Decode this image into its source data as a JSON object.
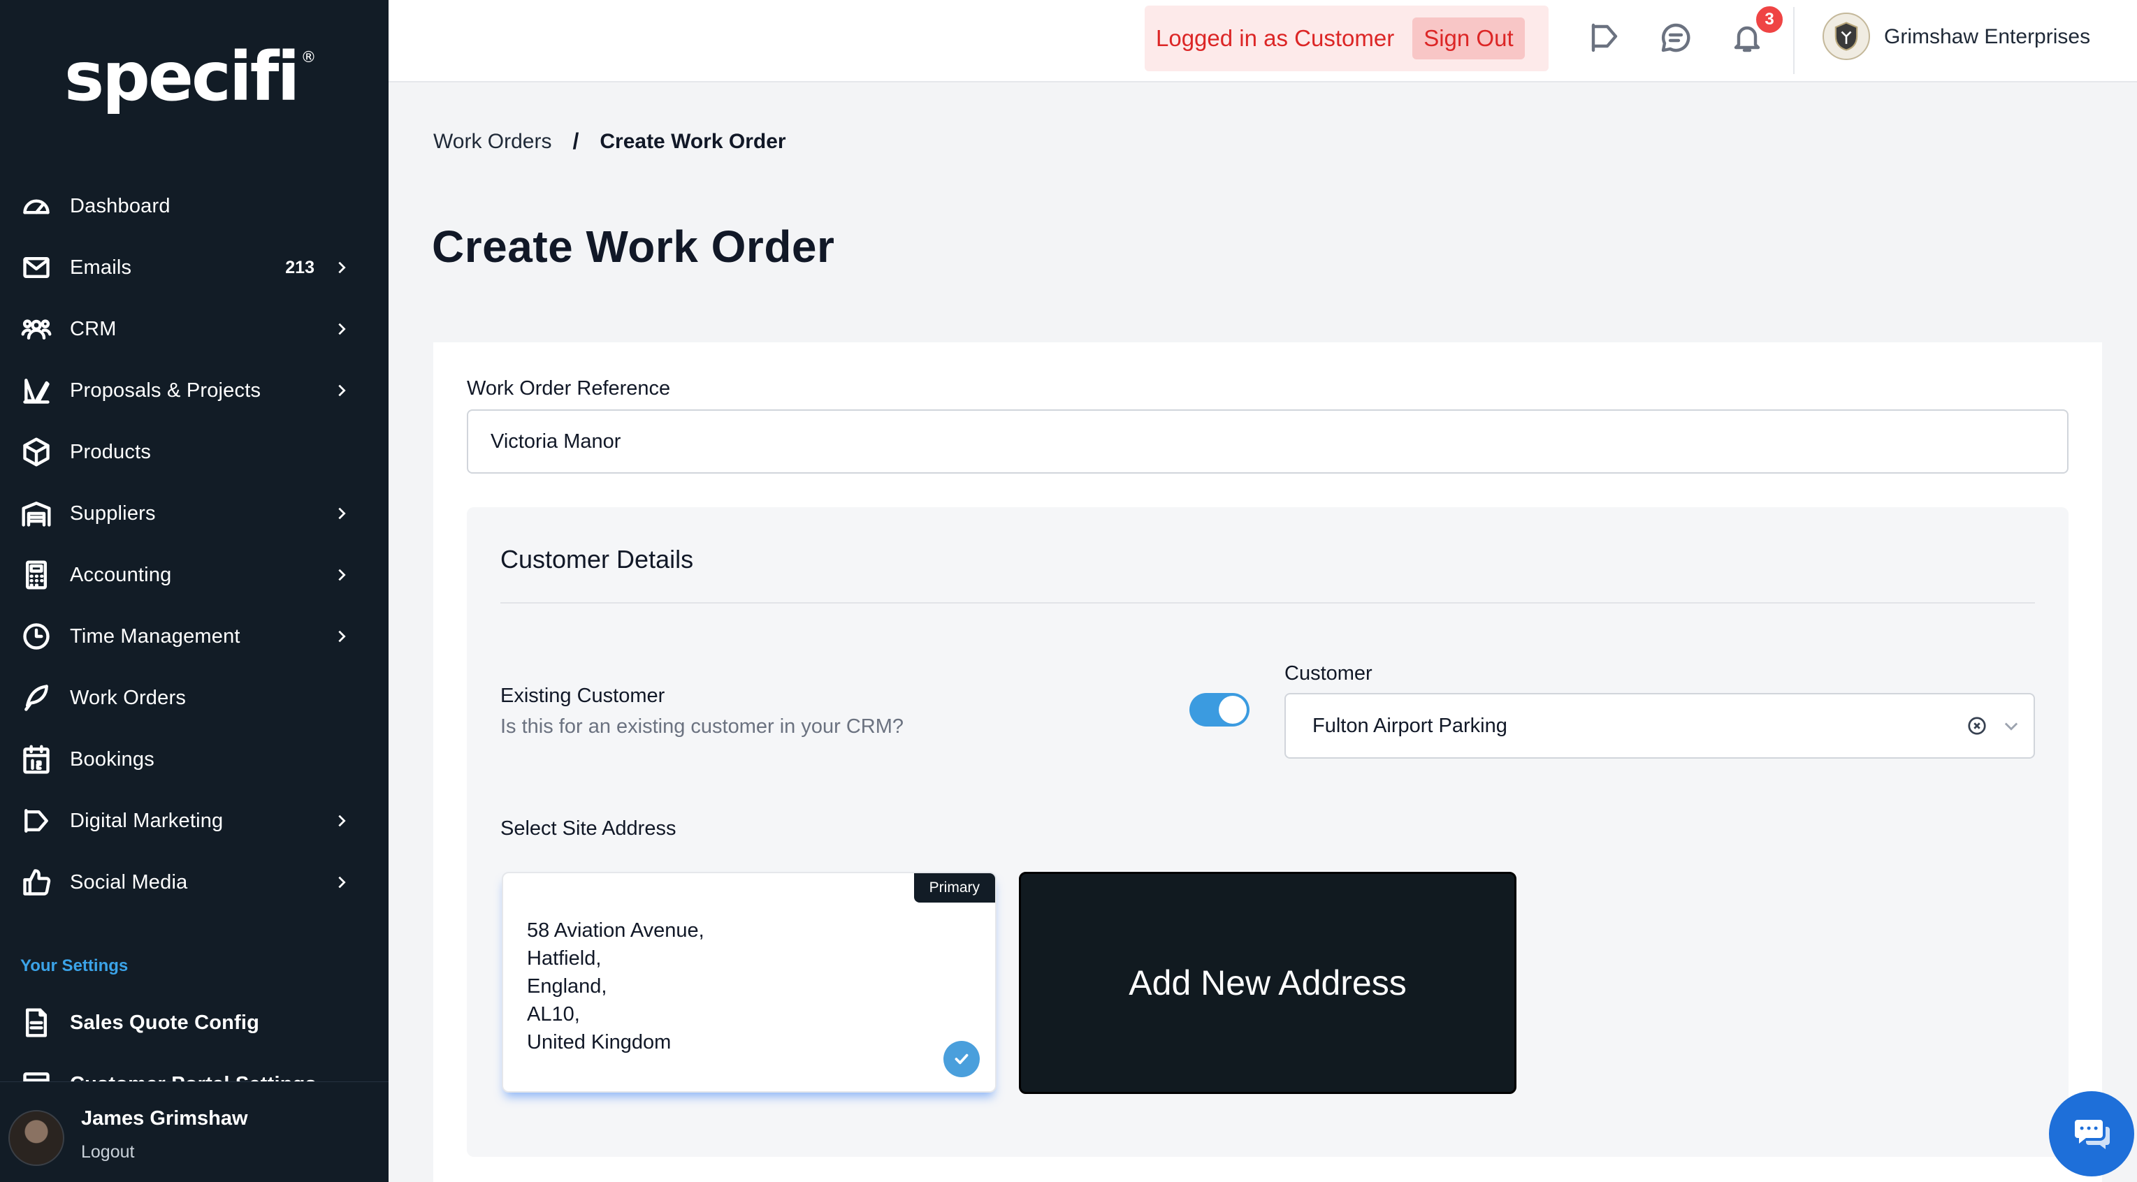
{
  "brand": {
    "logo_text": "specifi",
    "logo_mark": "®"
  },
  "sidebar": {
    "items": [
      {
        "label": "Dashboard",
        "icon": "dashboard-gauge-icon",
        "has_chevron": false
      },
      {
        "label": "Emails",
        "icon": "envelope-icon",
        "count": "213",
        "has_chevron": true
      },
      {
        "label": "CRM",
        "icon": "users-icon",
        "has_chevron": true
      },
      {
        "label": "Proposals & Projects",
        "icon": "design-tools-icon",
        "has_chevron": true
      },
      {
        "label": "Products",
        "icon": "box-icon",
        "has_chevron": false
      },
      {
        "label": "Suppliers",
        "icon": "warehouse-icon",
        "has_chevron": true
      },
      {
        "label": "Accounting",
        "icon": "calculator-icon",
        "has_chevron": true
      },
      {
        "label": "Time Management",
        "icon": "clock-icon",
        "has_chevron": true
      },
      {
        "label": "Work Orders",
        "icon": "feather-icon",
        "has_chevron": false
      },
      {
        "label": "Bookings",
        "icon": "calendar-icon",
        "has_chevron": false
      },
      {
        "label": "Digital Marketing",
        "icon": "megaphone-icon",
        "has_chevron": true
      },
      {
        "label": "Social Media",
        "icon": "thumbs-up-icon",
        "has_chevron": true
      }
    ],
    "settings_heading": "Your Settings",
    "settings_items": [
      {
        "label": "Sales Quote Config",
        "icon": "document-icon"
      },
      {
        "label": "Customer Portal Settings",
        "icon": "portal-icon"
      }
    ],
    "user": {
      "name": "James Grimshaw",
      "logout": "Logout"
    }
  },
  "topbar": {
    "login_status": "Logged in as Customer",
    "sign_out": "Sign Out",
    "notification_count": "3",
    "company_name": "Grimshaw Enterprises"
  },
  "breadcrumb": {
    "parent": "Work Orders",
    "separator": "/",
    "current": "Create Work Order"
  },
  "page": {
    "title": "Create Work Order"
  },
  "form": {
    "reference_label": "Work Order Reference",
    "reference_value": "Victoria Manor",
    "customer_section_title": "Customer Details",
    "existing_customer_label": "Existing Customer",
    "existing_customer_help": "Is this for an existing customer in your CRM?",
    "existing_customer_enabled": true,
    "customer_label": "Customer",
    "customer_value": "Fulton Airport Parking",
    "site_address_label": "Select Site Address",
    "address": {
      "tag": "Primary",
      "lines": [
        "58 Aviation Avenue,",
        "Hatfield,",
        "England,",
        "AL10,",
        "United Kingdom"
      ],
      "selected": true
    },
    "add_address_label": "Add New Address"
  },
  "colors": {
    "sidebar_bg": "#121c26",
    "accent_blue": "#3b9be0",
    "danger_red": "#dc2626",
    "danger_bg": "#fdeaea",
    "badge_red": "#ef4444"
  }
}
